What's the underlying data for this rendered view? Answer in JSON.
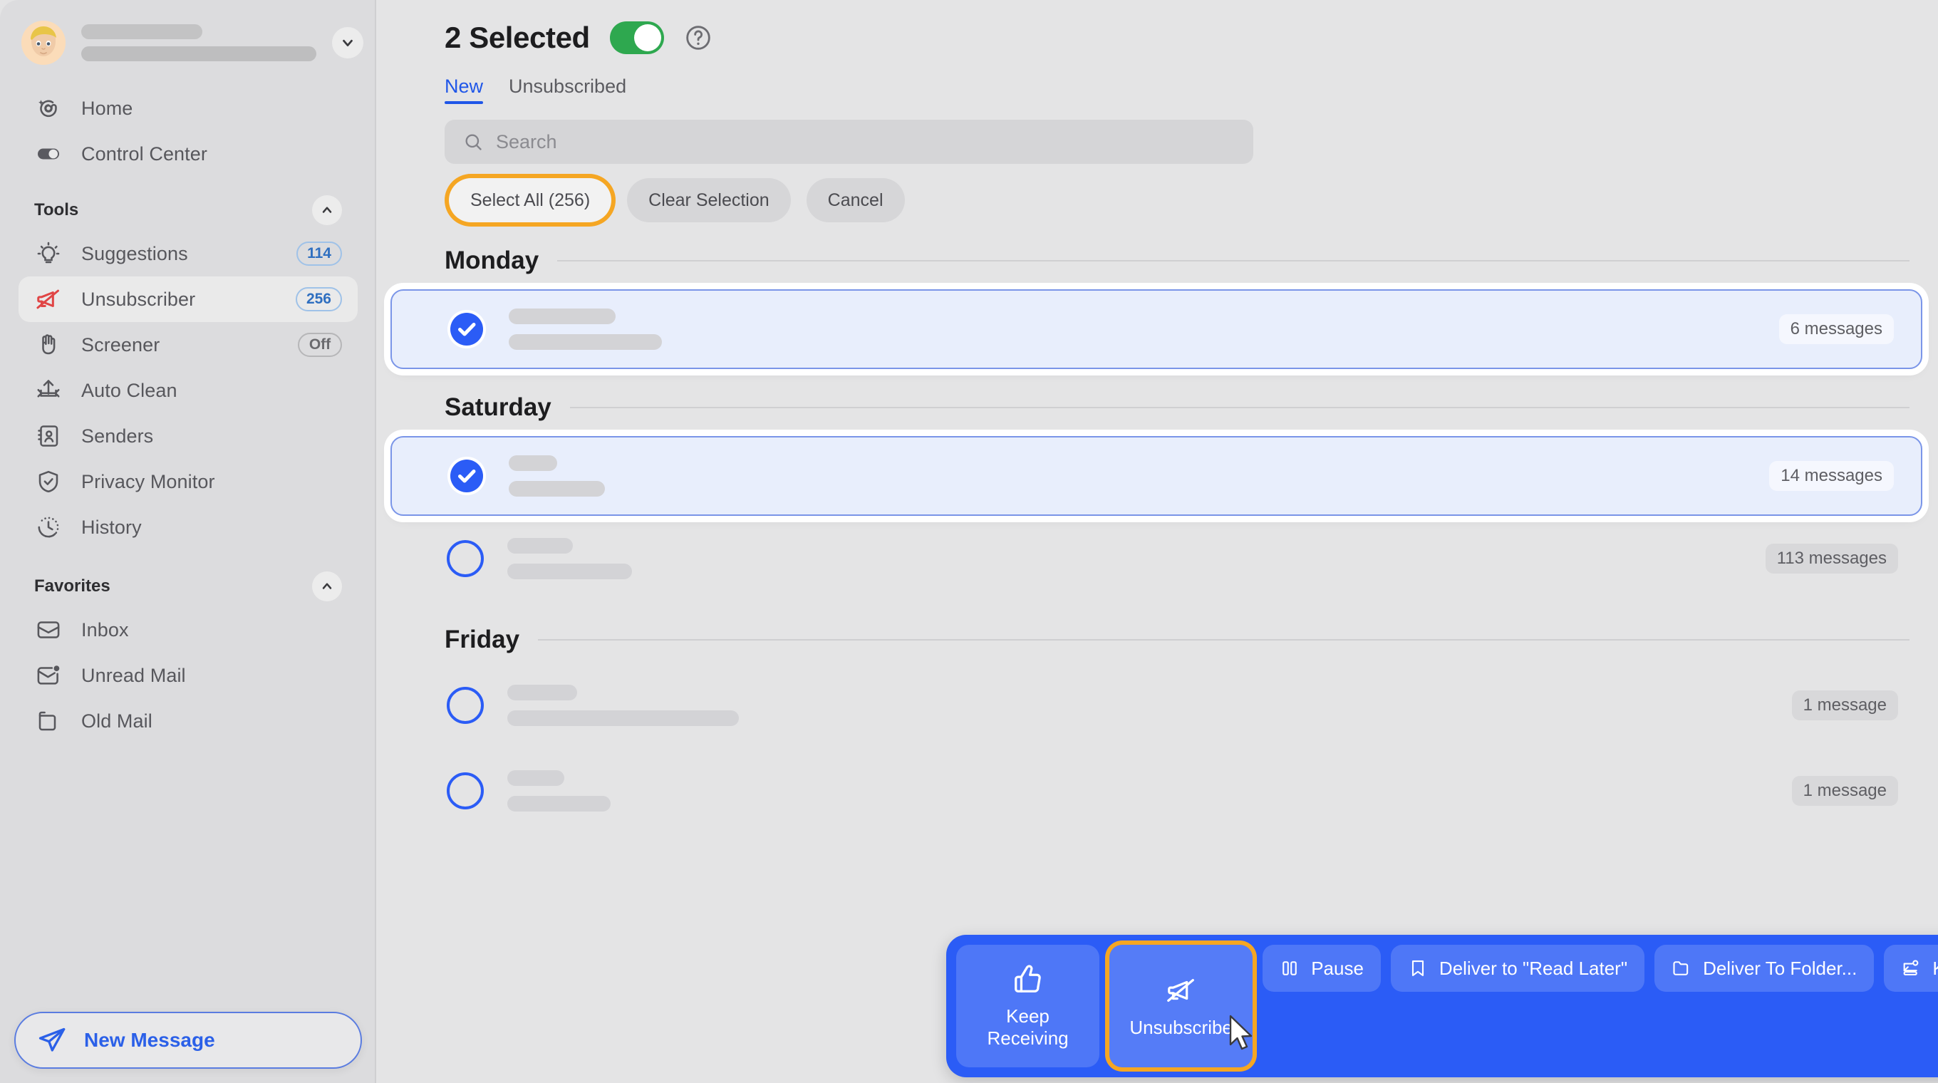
{
  "colors": {
    "accent_blue": "#2b5cf6",
    "sidebar_bg": "#dcdcde",
    "main_bg": "#e4e4e5",
    "toggle_green": "#2ea84f",
    "highlight_orange": "#f5a623",
    "selected_row_bg": "#e8eefc"
  },
  "sidebar": {
    "account": {
      "avatar": "memoji-avatar",
      "chevron": "chevron-down-icon"
    },
    "top_items": [
      {
        "label": "Home",
        "icon": "at-sparkle-icon"
      },
      {
        "label": "Control Center",
        "icon": "toggle-icon"
      }
    ],
    "tools_section": {
      "title": "Tools",
      "collapse_icon": "chevron-up-icon"
    },
    "tools_items": [
      {
        "label": "Suggestions",
        "icon": "lightbulb-icon",
        "badge": "114",
        "badge_type": "count",
        "active": false
      },
      {
        "label": "Unsubscriber",
        "icon": "megaphone-slash-icon",
        "badge": "256",
        "badge_type": "count",
        "active": true
      },
      {
        "label": "Screener",
        "icon": "hand-icon",
        "badge": "Off",
        "badge_type": "state",
        "active": false
      },
      {
        "label": "Auto Clean",
        "icon": "auto-clean-arrows-icon",
        "badge": "",
        "badge_type": "none",
        "active": false
      },
      {
        "label": "Senders",
        "icon": "contact-book-icon",
        "badge": "",
        "badge_type": "none",
        "active": false
      },
      {
        "label": "Privacy Monitor",
        "icon": "shield-check-icon",
        "badge": "",
        "badge_type": "none",
        "active": false
      },
      {
        "label": "History",
        "icon": "clock-icon",
        "badge": "",
        "badge_type": "none",
        "active": false
      }
    ],
    "favorites_section": {
      "title": "Favorites",
      "collapse_icon": "chevron-up-icon"
    },
    "favorites_items": [
      {
        "label": "Inbox",
        "icon": "envelope-icon"
      },
      {
        "label": "Unread Mail",
        "icon": "envelope-dot-icon"
      },
      {
        "label": "Old Mail",
        "icon": "archive-icon"
      }
    ],
    "new_message": {
      "label": "New Message",
      "icon": "paper-plane-icon"
    }
  },
  "header": {
    "title": "2 Selected",
    "toggle_on": true,
    "help_icon": "question-circle-icon",
    "tabs": [
      {
        "label": "New",
        "active": true
      },
      {
        "label": "Unsubscribed",
        "active": false
      }
    ],
    "search": {
      "placeholder": "Search",
      "value": "",
      "icon": "search-icon"
    },
    "actions": [
      {
        "label": "Select All (256)",
        "highlighted": true
      },
      {
        "label": "Clear Selection",
        "highlighted": false
      },
      {
        "label": "Cancel",
        "highlighted": false
      }
    ]
  },
  "list": {
    "groups": [
      {
        "day": "Monday",
        "rows": [
          {
            "selected": true,
            "count": "6 messages",
            "line1_w": 150,
            "line2_w": 215
          }
        ]
      },
      {
        "day": "Saturday",
        "rows": [
          {
            "selected": true,
            "count": "14 messages",
            "line1_w": 68,
            "line2_w": 135
          },
          {
            "selected": false,
            "count": "113 messages",
            "line1_w": 92,
            "line2_w": 175
          }
        ]
      },
      {
        "day": "Friday",
        "rows": [
          {
            "selected": false,
            "count": "1 message",
            "line1_w": 98,
            "line2_w": 325
          },
          {
            "selected": false,
            "count": "1 message",
            "line1_w": 80,
            "line2_w": 145
          }
        ]
      }
    ]
  },
  "action_bar": {
    "primary": [
      {
        "label": "Keep\nReceiving",
        "label_line1": "Keep",
        "label_line2": "Receiving",
        "icon": "thumbs-up-icon",
        "focused": false
      },
      {
        "label": "Unsubscribe",
        "label_line1": "Unsubscribe",
        "label_line2": "",
        "icon": "megaphone-slash-icon",
        "focused": true
      }
    ],
    "chips": [
      {
        "label": "Pause",
        "icon": "pause-icon"
      },
      {
        "label": "Deliver to \"Read Later\"",
        "icon": "bookmark-icon"
      },
      {
        "label": "Deliver To Folder...",
        "icon": "folder-icon"
      },
      {
        "label": "Keep Newest",
        "icon": "keep-newest-icon"
      }
    ],
    "close": {
      "icon": "close-icon"
    }
  }
}
